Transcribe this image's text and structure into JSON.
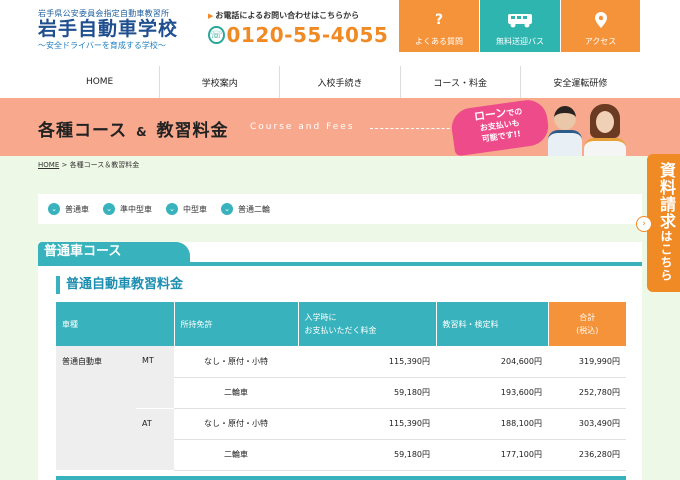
{
  "header": {
    "logo_sub": "岩手県公安委員会指定自動車教習所",
    "logo_main": "岩手自動車学校",
    "logo_tag": "〜安全ドライバーを育成する学校〜",
    "tel_label": "お電話によるお問い合わせはこちらから",
    "tel_number": "0120-55-4055",
    "quick_links": [
      {
        "label": "よくある質問",
        "icon": "question-icon"
      },
      {
        "label": "無料送迎バス",
        "icon": "bus-icon"
      },
      {
        "label": "アクセス",
        "icon": "map-pin-icon"
      }
    ]
  },
  "nav": {
    "items": [
      "HOME",
      "学校案内",
      "入校手続き",
      "コース・料金",
      "安全運転研修"
    ]
  },
  "banner": {
    "title_a": "各種コース",
    "title_amp": "&",
    "title_b": "教習料金",
    "subtitle_en": "Course and Fees",
    "loan_line1": "ローン",
    "loan_line1b": "での",
    "loan_line2": "お支払いも",
    "loan_line3": "可能です!!"
  },
  "breadcrumb": {
    "home": "HOME",
    "separator": " > ",
    "current": "各種コース＆教習料金"
  },
  "course_tabs": [
    "普通車",
    "準中型車",
    "中型車",
    "普通二輪"
  ],
  "side_tab": {
    "label_a": "資料請求",
    "label_b": "はこちら"
  },
  "course": {
    "heading": "普通車コース",
    "subheading": "普通自動車教習料金",
    "table": {
      "headers": {
        "vehicle": "車種",
        "license": "所持免許",
        "entry_line1": "入学時に",
        "entry_line2": "お支払いただく料金",
        "fees": "教習料・検定料",
        "total_line1": "合計",
        "total_line2": "(税込)"
      },
      "vehicle": "普通自動車",
      "groups": [
        {
          "transmission": "MT",
          "rows": [
            {
              "license": "なし・原付・小特",
              "entry": "115,390円",
              "fees": "204,600円",
              "total": "319,990円"
            },
            {
              "license": "二輪車",
              "entry": "59,180円",
              "fees": "193,600円",
              "total": "252,780円"
            }
          ]
        },
        {
          "transmission": "AT",
          "rows": [
            {
              "license": "なし・原付・小特",
              "entry": "115,390円",
              "fees": "188,100円",
              "total": "303,490円"
            },
            {
              "license": "二輪車",
              "entry": "59,180円",
              "fees": "177,100円",
              "total": "236,280円"
            }
          ]
        }
      ]
    }
  },
  "colors": {
    "teal": "#38b3bd",
    "orange": "#f5933b",
    "banner": "#f8a98d",
    "background": "#eef8e6",
    "pink": "#ee4b8a"
  }
}
